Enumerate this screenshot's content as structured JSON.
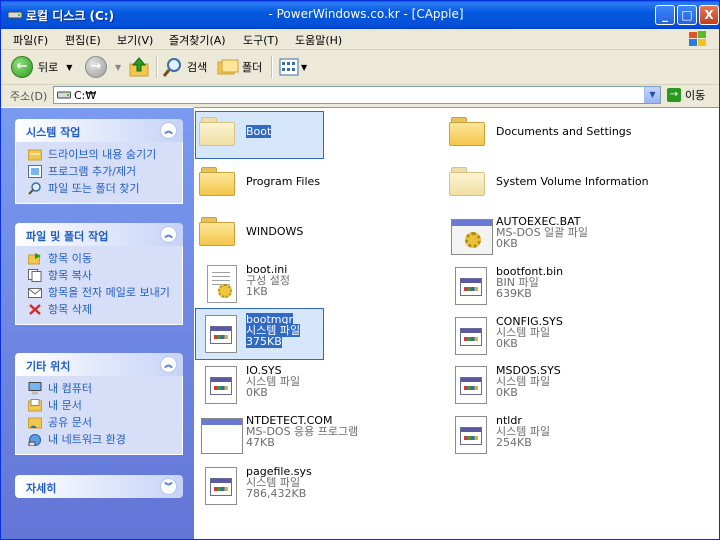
{
  "window": {
    "title_left": "로컬 디스크 (C:)",
    "title_center": "- PowerWindows.co.kr - [CApple]",
    "controls": {
      "minimize": "_",
      "maximize": "□",
      "close": "X"
    }
  },
  "menu": [
    "파일(F)",
    "편집(E)",
    "보기(V)",
    "즐겨찾기(A)",
    "도구(T)",
    "도움말(H)"
  ],
  "toolbar": {
    "back": "뒤로",
    "search": "검색",
    "folders": "폴더"
  },
  "address": {
    "label": "주소(D)",
    "value": "C:₩",
    "go": "이동"
  },
  "left_pane": {
    "system_tasks": {
      "title": "시스템 작업",
      "items": [
        "드라이브의 내용 숨기기",
        "프로그램 추가/제거",
        "파일 또는 폴더 찾기"
      ]
    },
    "file_tasks": {
      "title": "파일 및 폴더 작업",
      "items": [
        "항목 이동",
        "항목 복사",
        "항목을 전자 메일로 보내기",
        "항목 삭제"
      ]
    },
    "other_places": {
      "title": "기타 위치",
      "items": [
        "내 컴퓨터",
        "내 문서",
        "공유 문서",
        "내 네트워크 환경"
      ]
    },
    "details": {
      "title": "자세히"
    }
  },
  "files": [
    {
      "name": "Boot",
      "icon": "folder-icon",
      "selected": true
    },
    {
      "name": "Documents and Settings",
      "icon": "folder-icon"
    },
    {
      "name": "Program Files",
      "icon": "folder-icon"
    },
    {
      "name": "System Volume Information",
      "icon": "folder-icon"
    },
    {
      "name": "WINDOWS",
      "icon": "folder-icon"
    },
    {
      "name": "AUTOEXEC.BAT",
      "type": "MS-DOS 일괄 파일",
      "size": "0KB",
      "icon": "batch-file-icon"
    },
    {
      "name": "boot.ini",
      "type": "구성 설정",
      "size": "1KB",
      "icon": "config-file-icon"
    },
    {
      "name": "bootfont.bin",
      "type": "BIN 파일",
      "size": "639KB",
      "icon": "system-file-icon"
    },
    {
      "name": "bootmgr",
      "type": "시스템 파일",
      "size": "375KB",
      "icon": "system-file-icon",
      "selected": true
    },
    {
      "name": "CONFIG.SYS",
      "type": "시스템 파일",
      "size": "0KB",
      "icon": "system-file-icon"
    },
    {
      "name": "IO.SYS",
      "type": "시스템 파일",
      "size": "0KB",
      "icon": "system-file-icon"
    },
    {
      "name": "MSDOS.SYS",
      "type": "시스템 파일",
      "size": "0KB",
      "icon": "system-file-icon"
    },
    {
      "name": "NTDETECT.COM",
      "type": "MS-DOS 응용 프로그램",
      "size": "47KB",
      "icon": "application-icon"
    },
    {
      "name": "ntldr",
      "type": "시스템 파일",
      "size": "254KB",
      "icon": "system-file-icon"
    },
    {
      "name": "pagefile.sys",
      "type": "시스템 파일",
      "size": "786,432KB",
      "icon": "system-file-icon"
    }
  ]
}
